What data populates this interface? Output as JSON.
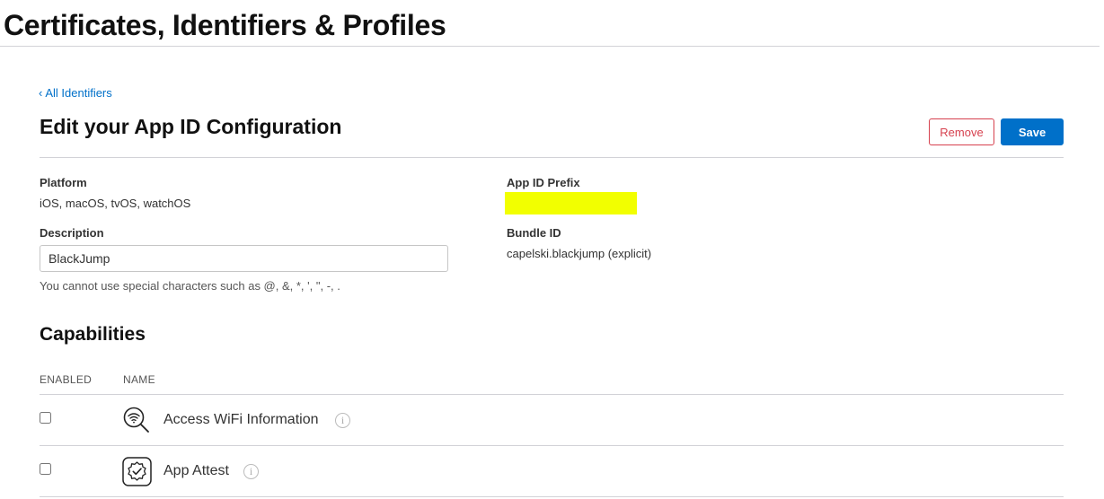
{
  "header": {
    "title": "Certificates, Identifiers & Profiles"
  },
  "nav": {
    "back_link": "All Identifiers"
  },
  "form": {
    "title": "Edit your App ID Configuration",
    "remove_label": "Remove",
    "save_label": "Save",
    "platform": {
      "label": "Platform",
      "value": "iOS, macOS, tvOS, watchOS"
    },
    "app_id_prefix": {
      "label": "App ID Prefix"
    },
    "description": {
      "label": "Description",
      "value": "BlackJump",
      "hint": "You cannot use special characters such as @, &, *, ', \", -, ."
    },
    "bundle_id": {
      "label": "Bundle ID",
      "value": "capelski.blackjump (explicit)"
    }
  },
  "capabilities": {
    "title": "Capabilities",
    "columns": {
      "enabled": "ENABLED",
      "name": "NAME"
    },
    "items": [
      {
        "name": "Access WiFi Information",
        "icon": "wifi-search-icon",
        "enabled": false
      },
      {
        "name": "App Attest",
        "icon": "app-attest-badge-icon",
        "enabled": false
      }
    ]
  },
  "colors": {
    "accent": "#0070c9",
    "danger": "#d6404e",
    "redaction": "#f2ff00"
  }
}
